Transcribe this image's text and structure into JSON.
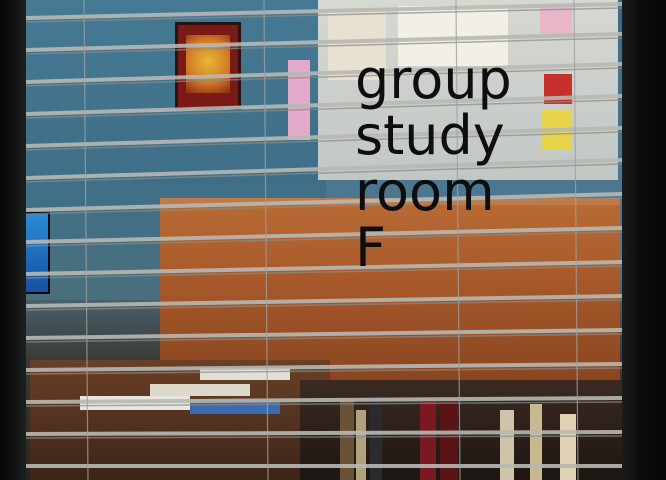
{
  "sign": {
    "line1": "group",
    "line2": "study",
    "line3": "room",
    "line4": "F"
  },
  "colors": {
    "wall": "#457994",
    "desk": "#b86a34",
    "lettering": "#0e0e10",
    "blind_slat": "#b7b9b4"
  }
}
